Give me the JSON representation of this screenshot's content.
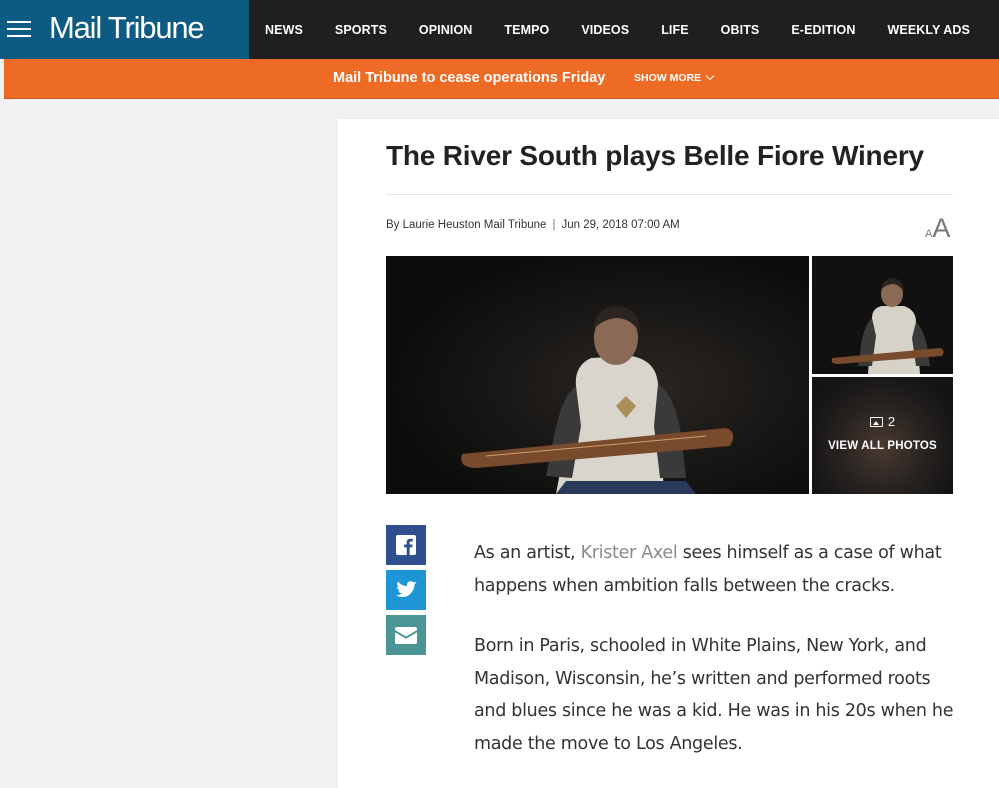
{
  "header": {
    "logo_text": "Mail Tribune",
    "nav": [
      "NEWS",
      "SPORTS",
      "OPINION",
      "TEMPO",
      "VIDEOS",
      "LIFE",
      "OBITS",
      "E-EDITION",
      "WEEKLY ADS"
    ]
  },
  "alert": {
    "text": "Mail Tribune to cease operations Friday",
    "show_more": "SHOW MORE"
  },
  "article": {
    "title": "The River South plays Belle Fiore Winery",
    "byline": "By Laurie Heuston Mail Tribune",
    "separator": "|",
    "date": "Jun 29, 2018 07:00 AM",
    "font_size_small": "A",
    "font_size_large": "A",
    "gallery": {
      "count": "2",
      "view_all": "VIEW ALL PHOTOS"
    },
    "paragraph1": {
      "before": "As an artist, ",
      "link": "Krister Axel",
      "after": " sees himself as a case of what happens when ambition falls between the cracks."
    },
    "paragraph2": "Born in Paris, schooled in White Plains, New York, and Madison, Wisconsin, he’s written and performed roots and blues since he was a kid. He was in his 20s when he made the move to Los Angeles."
  },
  "share": {
    "facebook_icon": "facebook-icon",
    "twitter_icon": "twitter-icon",
    "email_icon": "envelope-icon"
  },
  "colors": {
    "nav_bg": "#1f1f1f",
    "brand_blue": "#0d5b82",
    "alert_orange": "#ee6b26",
    "facebook": "#2f4f8f",
    "twitter": "#1e96d6",
    "email": "#4b9595"
  }
}
